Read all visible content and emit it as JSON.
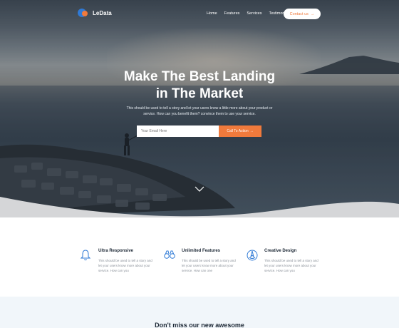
{
  "brand": {
    "name": "LeData"
  },
  "nav": {
    "links": [
      "Home",
      "Features",
      "Services",
      "Testimonials"
    ],
    "cta_label": "Contact us"
  },
  "hero": {
    "title_line1": "Make The Best Landing",
    "title_line2": "in The Market",
    "subtitle_line1": "This should be used to tell a story and let your users know a little more about your product or",
    "subtitle_line2": "service. How can you benefit them? convince them to use your service.",
    "email_placeholder": "Your Email Here",
    "cta_label": "Call To Action"
  },
  "features": [
    {
      "icon": "bell-icon",
      "title": "Ultra Responsive",
      "text": "This should be used to tell a story and let your users know more about your service. How can you"
    },
    {
      "icon": "binoculars-icon",
      "title": "Unlimited Features",
      "text": "This should be used to tell a story and let your users know more about your service. How can one"
    },
    {
      "icon": "compass-icon",
      "title": "Creative Design",
      "text": "This should be used to tell a story and let your users know more about your service. How can you"
    }
  ],
  "next_section": {
    "heading": "Don't miss our new awesome"
  },
  "colors": {
    "accent": "#f07a3c",
    "brand_blue": "#2f7ad6",
    "icon_blue": "#2f7ad6"
  }
}
